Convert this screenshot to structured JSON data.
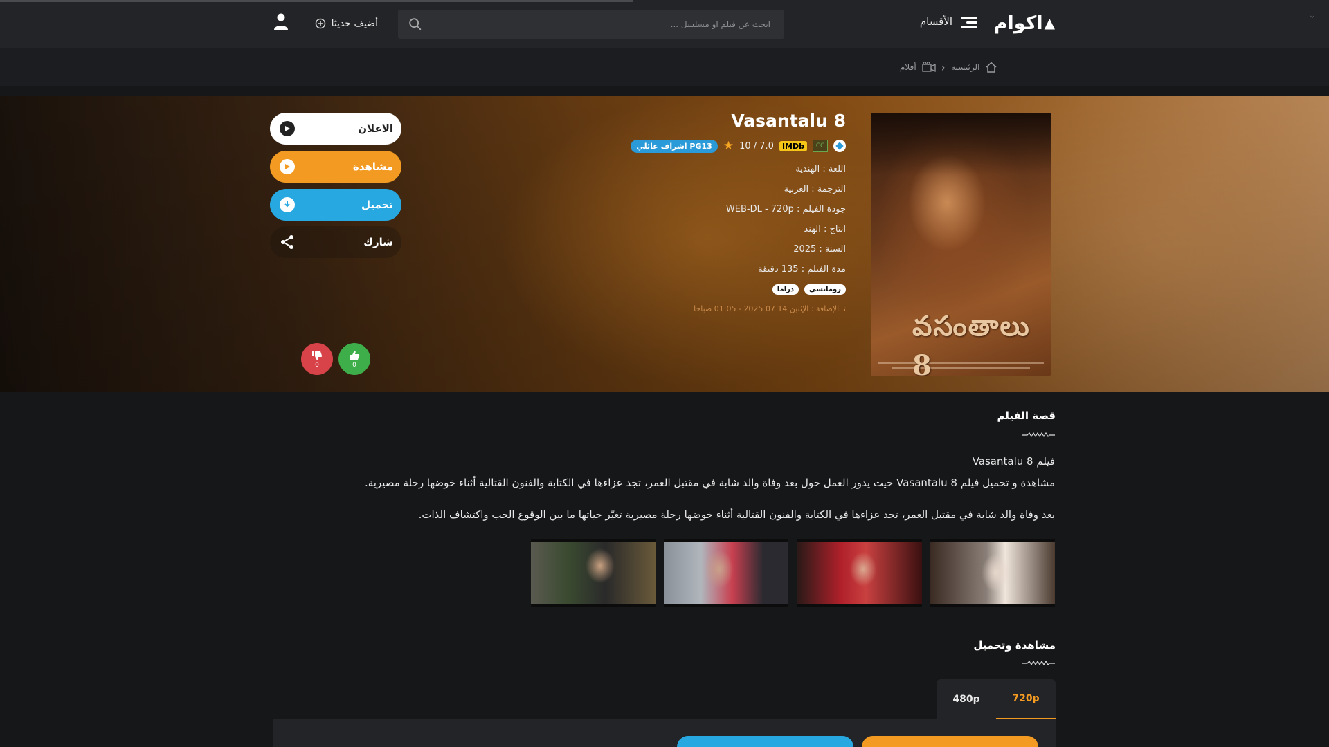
{
  "header": {
    "logo_text": "اكوام",
    "categories_label": "الأقسام",
    "search_placeholder": "ابحث عن فيلم او مسلسل ...",
    "added_recently_label": "أضيف حديثا"
  },
  "breadcrumb": {
    "home_label": "الرئيسية",
    "movies_label": "أفلام"
  },
  "movie": {
    "title": "Vasantalu 8",
    "poster_title": "వసంతాలు 8",
    "imdb_label": "IMDb",
    "subtitle_badge": "CC",
    "rating": "7.0",
    "rating_max": "10",
    "age_rating": "PG13 اشراف عائلي",
    "language": "اللغة : الهندية",
    "translation": "الترجمة : العربية",
    "quality": "جودة الفيلم : WEB-DL - 720p",
    "production": "انتاج : الهند",
    "year": "السنة : 2025",
    "duration": "مدة الفيلم : 135 دقيقة",
    "genres": [
      "رومانسي",
      "دراما"
    ],
    "added_on": "تـ الإضافة : الإثنين 14 07 2025 - 01:05 صباحا"
  },
  "actions": {
    "trailer": "الاعلان",
    "watch": "مشاهدة",
    "download": "تحميل",
    "share": "شارك"
  },
  "votes": {
    "likes": "0",
    "dislikes": "0"
  },
  "story": {
    "heading": "قصة الفيلم",
    "line1": "فيلم Vasantalu 8",
    "line2": "مشاهدة و تحميل فيلم Vasantalu 8  حيث يدور العمل حول بعد وفاة والد شابة في مقتبل العمر، تجد عزاءها في الكتابة والفنون القتالية أثناء خوضها رحلة مصيرية.",
    "line3": "بعد وفاة والد شابة في مقتبل العمر، تجد عزاءها في الكتابة والفنون القتالية أثناء خوضها رحلة مصيرية تغيّر حياتها ما بين الوقوع الحب واكتشاف الذات."
  },
  "watch_download": {
    "heading": "مشاهدة وتحميل",
    "tabs": [
      "720p",
      "480p"
    ],
    "active_tab": "720p"
  },
  "colors": {
    "accent_orange": "#f29a22",
    "accent_blue": "#28a8e0",
    "like_green": "#3eae4a",
    "dislike_red": "#d8434a"
  }
}
